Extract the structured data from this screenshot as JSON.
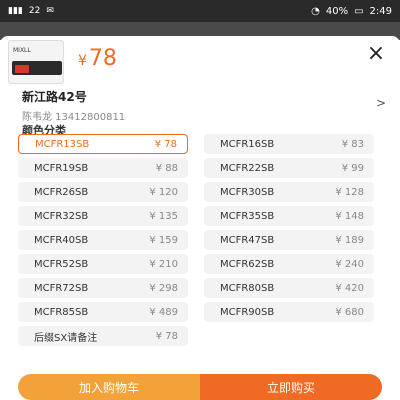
{
  "status_bar": {
    "left_text": "22",
    "battery": "40%",
    "time": "2:49"
  },
  "product": {
    "price_symbol": "¥",
    "price": "78",
    "brand_text": "MIXLL"
  },
  "address": {
    "line1": "新江路42号",
    "line2": "陈韦龙 13412800811"
  },
  "section_title": "颜色分类",
  "options": [
    {
      "label": "MCFR13SB",
      "price": "¥ 78",
      "selected": true
    },
    {
      "label": "MCFR16SB",
      "price": "¥ 83"
    },
    {
      "label": "MCFR19SB",
      "price": "¥ 88"
    },
    {
      "label": "MCFR22SB",
      "price": "¥ 99"
    },
    {
      "label": "MCFR26SB",
      "price": "¥ 120"
    },
    {
      "label": "MCFR30SB",
      "price": "¥ 128"
    },
    {
      "label": "MCFR32SB",
      "price": "¥ 135"
    },
    {
      "label": "MCFR35SB",
      "price": "¥ 148"
    },
    {
      "label": "MCFR40SB",
      "price": "¥ 159"
    },
    {
      "label": "MCFR47SB",
      "price": "¥ 189"
    },
    {
      "label": "MCFR52SB",
      "price": "¥ 210"
    },
    {
      "label": "MCFR62SB",
      "price": "¥ 240"
    },
    {
      "label": "MCFR72SB",
      "price": "¥ 298"
    },
    {
      "label": "MCFR80SB",
      "price": "¥ 420"
    },
    {
      "label": "MCFR85SB",
      "price": "¥ 489"
    },
    {
      "label": "MCFR90SB",
      "price": "¥ 680"
    },
    {
      "label": "后缀SX请备注",
      "price": "¥ 78"
    }
  ],
  "actions": {
    "add_to_cart": "加入购物车",
    "buy_now": "立即购买"
  },
  "colors": {
    "accent": "#f36b1c",
    "cart": "#f3a23a",
    "buy": "#ef6a22"
  }
}
